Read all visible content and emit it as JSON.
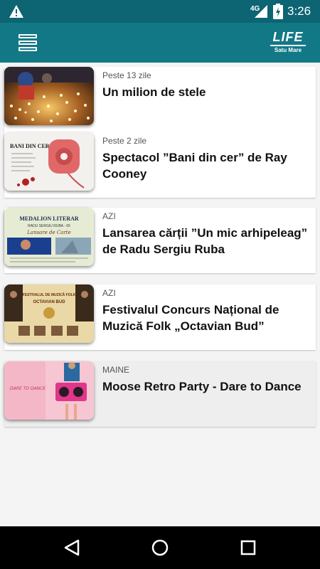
{
  "status_bar": {
    "network": "4G",
    "time": "3:26",
    "icons": [
      "warning-icon",
      "signal-icon",
      "battery-charging-icon"
    ]
  },
  "app_bar": {
    "menu_icon": "list-menu-icon",
    "logo_main": "LIFE",
    "logo_sub": "Satu Mare"
  },
  "events": [
    {
      "when": "Peste 13 zile",
      "title": "Un milion de stele"
    },
    {
      "when": "Peste 2 zile",
      "title": "Spectacol ”Bani din cer” de Ray Cooney"
    },
    {
      "when": "AZI",
      "title": "Lansarea cărții ”Un mic arhipeleag” de Radu Sergiu Ruba"
    },
    {
      "when": "AZI",
      "title": "Festivalul Concurs Național de Muzică Folk „Octavian Bud”"
    },
    {
      "when": "MAINE",
      "title": "Moose Retro Party - Dare to Dance"
    }
  ],
  "poster_text": {
    "p2": "BANI DIN CER",
    "p3_title": "MEDALION LITERAR",
    "p3_sub": "RADU SERGIU RUBA - 65",
    "p3_script": "Lansare de Carte",
    "p4_title": "FESTIVALUL DE MUZICĂ FOLK",
    "p4_sub": "OCTAVIAN BUD",
    "p5": "DARE TO DANCE"
  },
  "nav_bar": {
    "back_icon": "back-triangle-icon",
    "home_icon": "home-circle-icon",
    "recents_icon": "recents-square-icon"
  },
  "colors": {
    "status_bar": "#0d6472",
    "app_bar": "#127886",
    "highlight_row": "#eeeeee"
  }
}
